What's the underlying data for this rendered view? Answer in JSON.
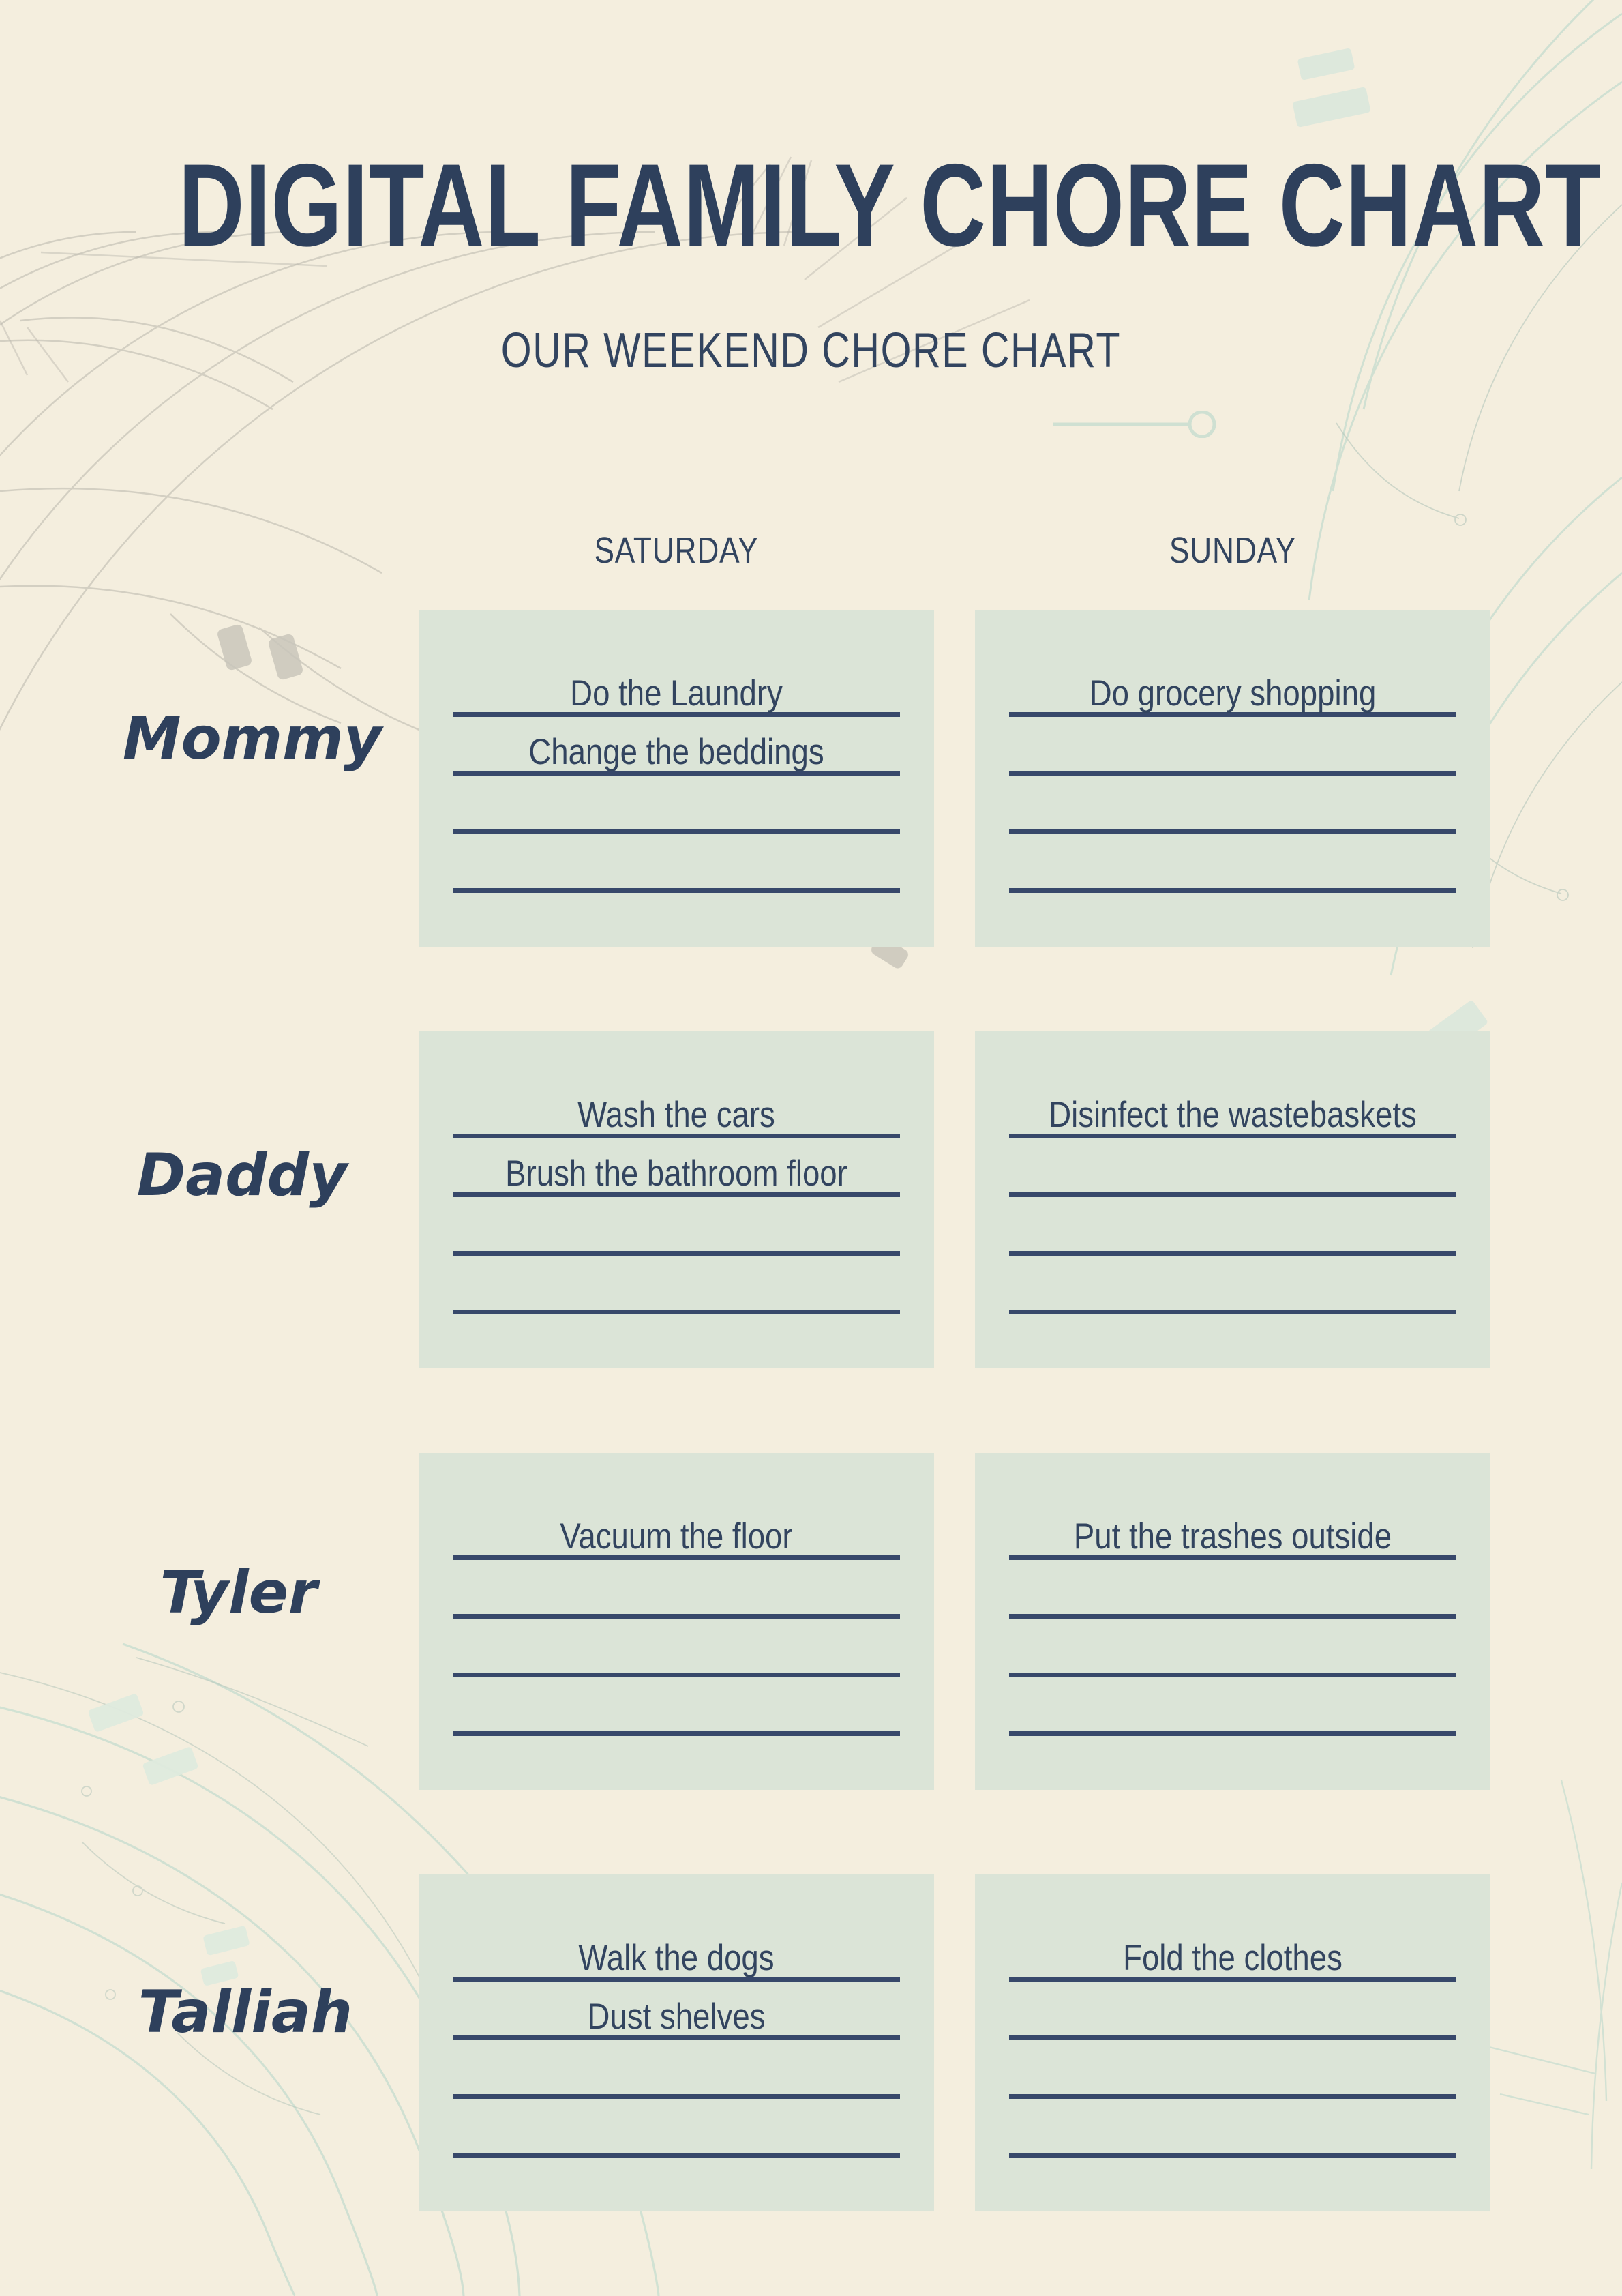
{
  "header": {
    "title": "DIGITAL FAMILY CHORE CHART",
    "subtitle": "OUR WEEKEND CHORE CHART"
  },
  "colors": {
    "page_background": "#f4eede",
    "card_background": "#dbe4d7",
    "ink": "#2e405c",
    "rule": "#37486a",
    "decor_gray": "#b9b6ac",
    "decor_green": "#cfe0d2"
  },
  "columns": [
    {
      "label": "SATURDAY"
    },
    {
      "label": "SUNDAY"
    }
  ],
  "rows": [
    {
      "name": "Mommy",
      "saturday": {
        "tasks": [
          "Do the Laundry",
          "Change the beddings"
        ],
        "blank_lines": 2
      },
      "sunday": {
        "tasks": [
          "Do grocery shopping"
        ],
        "blank_lines": 3
      }
    },
    {
      "name": "Daddy",
      "saturday": {
        "tasks": [
          "Wash the cars",
          "Brush the bathroom floor"
        ],
        "blank_lines": 2
      },
      "sunday": {
        "tasks": [
          "Disinfect the wastebaskets"
        ],
        "blank_lines": 3
      }
    },
    {
      "name": "Tyler",
      "saturday": {
        "tasks": [
          "Vacuum the floor"
        ],
        "blank_lines": 3
      },
      "sunday": {
        "tasks": [
          "Put the trashes outside"
        ],
        "blank_lines": 3
      }
    },
    {
      "name": "Talliah",
      "saturday": {
        "tasks": [
          "Walk the dogs",
          "Dust shelves"
        ],
        "blank_lines": 2
      },
      "sunday": {
        "tasks": [
          "Fold the clothes"
        ],
        "blank_lines": 3
      }
    }
  ]
}
